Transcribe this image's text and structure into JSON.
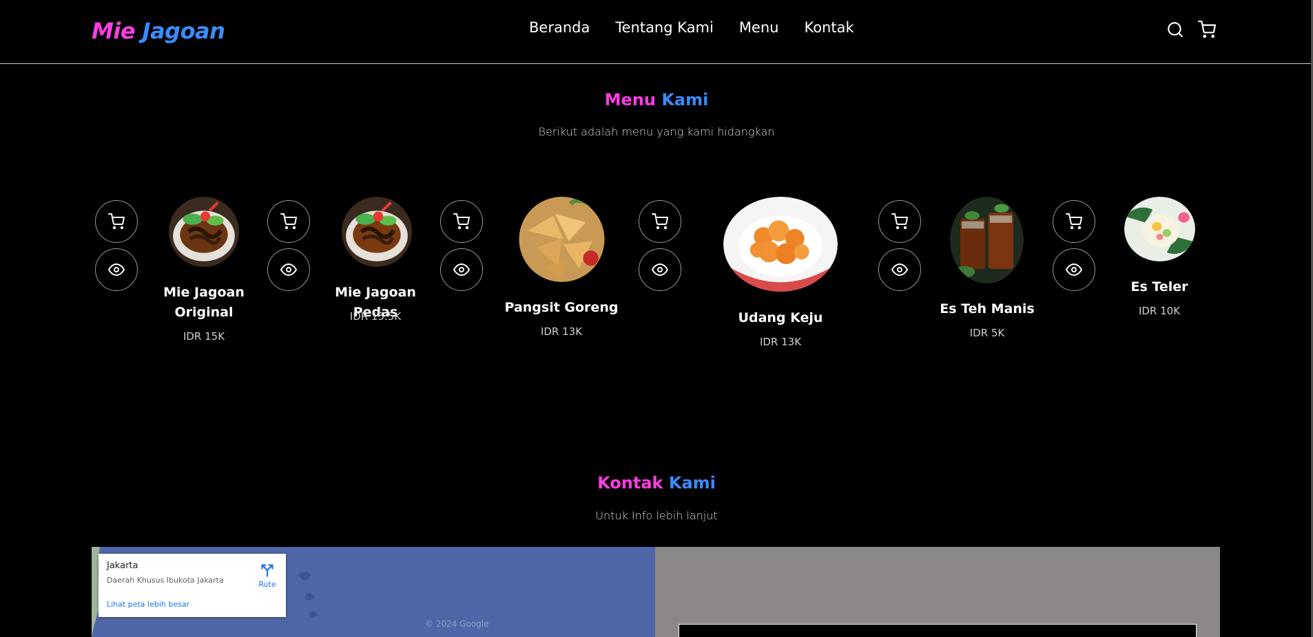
{
  "brand": {
    "part1": "Mie",
    "part2": "Jagoan"
  },
  "nav": [
    "Beranda",
    "Tentang Kami",
    "Menu",
    "Kontak"
  ],
  "icons": {
    "search": "search-icon",
    "cart": "shopping-cart-icon",
    "view": "eye-icon",
    "route": "directions-icon"
  },
  "menu_section": {
    "title_part1": "Menu",
    "title_part2": "Kami",
    "subtitle": "Berikut adalah menu yang kami hidangkan"
  },
  "menu_items": [
    {
      "name_line1": "Mie Jagoan",
      "name_line2": "Original",
      "price": "IDR 15K"
    },
    {
      "name_line1": "Mie Jagoan Pedas",
      "name_line2": "",
      "price": "IDR 15.5K"
    },
    {
      "name_line1": "Pangsit Goreng",
      "name_line2": "",
      "price": "IDR 13K"
    },
    {
      "name_line1": "Udang Keju",
      "name_line2": "",
      "price": "IDR 13K"
    },
    {
      "name_line1": "Es Teh Manis",
      "name_line2": "",
      "price": "IDR 5K"
    },
    {
      "name_line1": "Es Teler",
      "name_line2": "",
      "price": "IDR 10K"
    }
  ],
  "contact_section": {
    "title_part1": "Kontak",
    "title_part2": "Kami",
    "subtitle": "Untuk Info lebih lanjut"
  },
  "map": {
    "city": "Jakarta",
    "region": "Daerah Khusus Ibukota Jakarta",
    "route_label": "Rute",
    "bigger_map_link": "Lihat peta lebih besar",
    "copyright": "© 2024 Google"
  },
  "colors": {
    "accent_pink": "#ff3de3",
    "accent_blue": "#3b8bff",
    "background": "#000000"
  }
}
